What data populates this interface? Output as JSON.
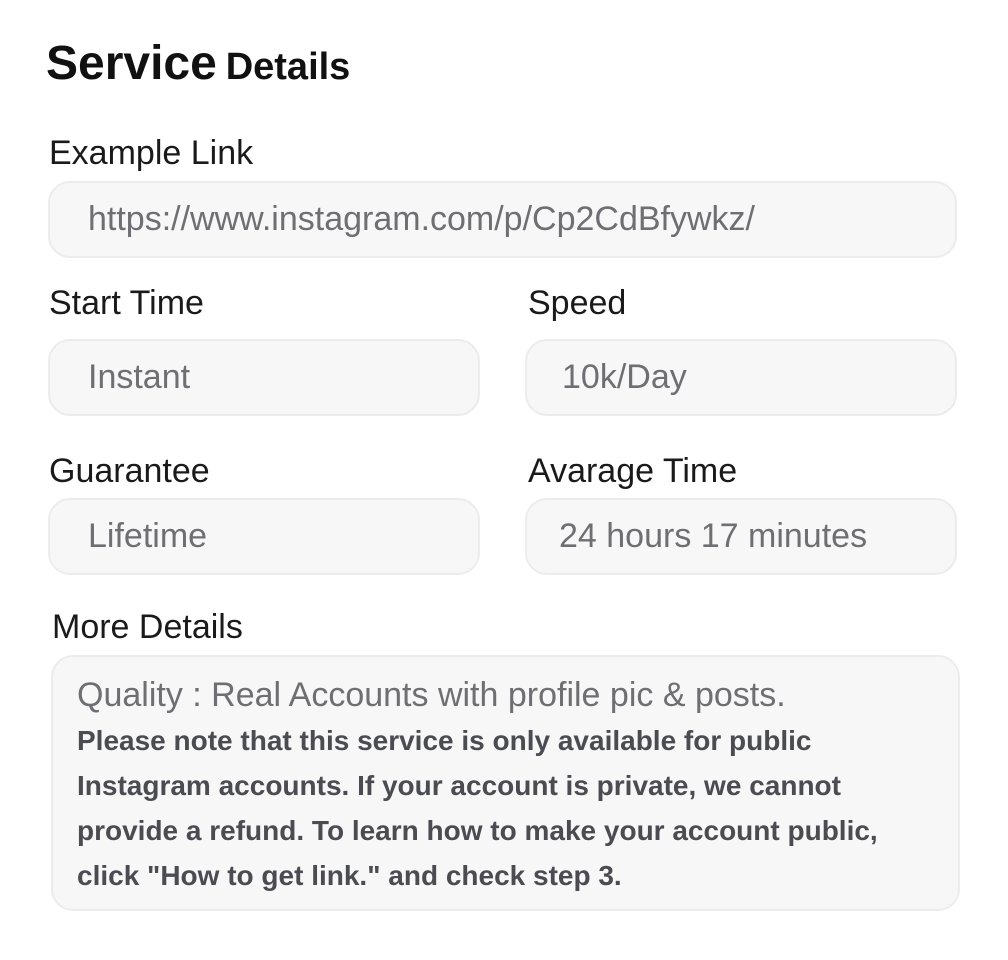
{
  "title": {
    "part1": "Service",
    "part2": "Details"
  },
  "fields": {
    "example_link": {
      "label": "Example Link",
      "value": "https://www.instagram.com/p/Cp2CdBfywkz/"
    },
    "start_time": {
      "label": "Start Time",
      "value": "Instant"
    },
    "speed": {
      "label": "Speed",
      "value": "10k/Day"
    },
    "guarantee": {
      "label": "Guarantee",
      "value": "Lifetime"
    },
    "average_time": {
      "label": "Avarage Time",
      "value": "24 hours 17 minutes"
    }
  },
  "more_details": {
    "label": "More Details",
    "quality": "Quality : Real Accounts with profile pic & posts.",
    "note": "Please note that this service is only available for public Instagram accounts. If your account is private, we cannot provide a refund. To learn how to make your account public, click \"How to get link.\" and check step 3."
  },
  "colors": {
    "field_background": "#f7f7f7",
    "field_border": "#ececec",
    "value_text": "#6e6e73",
    "title_text": "#111111"
  }
}
